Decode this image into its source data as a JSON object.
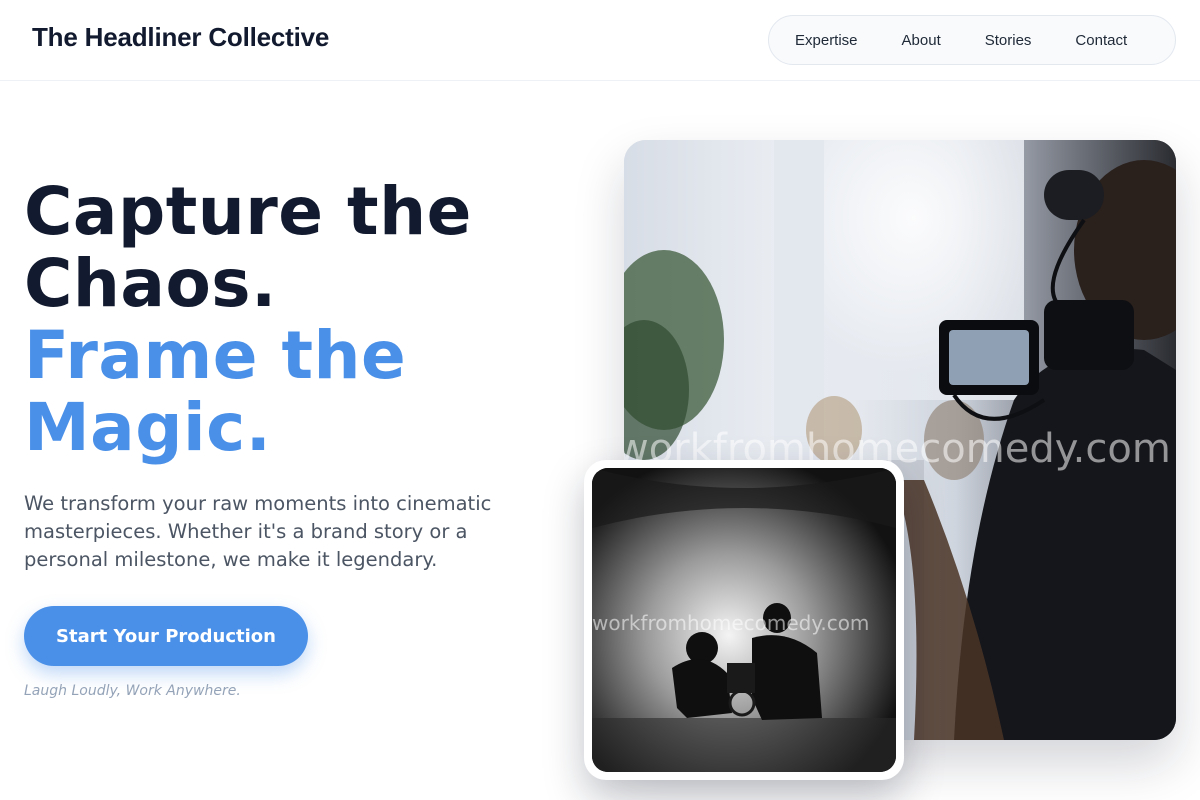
{
  "brand": {
    "name": "The Headliner Collective"
  },
  "nav": {
    "items": [
      {
        "label": "Expertise"
      },
      {
        "label": "About"
      },
      {
        "label": "Stories"
      },
      {
        "label": "Contact"
      }
    ]
  },
  "hero": {
    "headline_line1": "Capture the",
    "headline_line2": "Chaos.",
    "headline_accent_line1": "Frame the",
    "headline_accent_line2": "Magic.",
    "lede": "We transform your raw moments into cinematic masterpieces. Whether it's a brand story or a personal milestone, we make it legendary.",
    "cta_label": "Start Your Production",
    "tagline": "Laugh Loudly, Work Anywhere."
  },
  "images": {
    "main_watermark": "workfromhomecomedy.com",
    "secondary_watermark": "workfromhomecomedy.com"
  },
  "colors": {
    "accent": "#4a90e8",
    "heading": "#111a2e",
    "body_text": "#4b5563",
    "muted": "#94a3b8"
  }
}
